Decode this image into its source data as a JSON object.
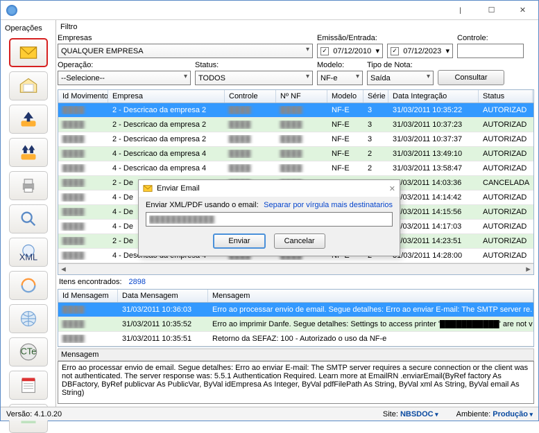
{
  "window": {
    "title": ""
  },
  "sidebar": {
    "header": "Operações"
  },
  "filter": {
    "header": "Filtro",
    "empresasLabel": "Empresas",
    "empresasValue": "QUALQUER EMPRESA",
    "operacaoLabel": "Operação:",
    "operacaoValue": "--Selecione--",
    "statusLabel": "Status:",
    "statusValue": "TODOS",
    "emissaoLabel": "Emissão/Entrada:",
    "date1": "07/12/2010",
    "date2": "07/12/2023",
    "modeloLabel": "Modelo:",
    "modeloValue": "NF-e",
    "tipoNotaLabel": "Tipo de Nota:",
    "tipoNotaValue": "Saída",
    "controleLabel": "Controle:",
    "consultar": "Consultar"
  },
  "grid1": {
    "headers": [
      "Id Movimento",
      "Empresa",
      "Controle",
      "Nº NF",
      "Modelo",
      "Série",
      "Data Integração",
      "Status"
    ],
    "rows": [
      {
        "e": "2 - Descricao da empresa 2",
        "m": "NF-E",
        "s": "3",
        "d": "31/03/2011 10:35:22",
        "st": "AUTORIZAD"
      },
      {
        "e": "2 - Descricao da empresa 2",
        "m": "NF-E",
        "s": "3",
        "d": "31/03/2011 10:37:23",
        "st": "AUTORIZAD"
      },
      {
        "e": "2 - Descricao da empresa 2",
        "m": "NF-E",
        "s": "3",
        "d": "31/03/2011 10:37:37",
        "st": "AUTORIZAD"
      },
      {
        "e": "4 - Descricao da empresa 4",
        "m": "NF-E",
        "s": "2",
        "d": "31/03/2011 13:49:10",
        "st": "AUTORIZAD"
      },
      {
        "e": "4 - Descricao da empresa 4",
        "m": "NF-E",
        "s": "2",
        "d": "31/03/2011 13:58:47",
        "st": "AUTORIZAD"
      },
      {
        "e": "2 - De",
        "m": "",
        "s": "",
        "d": "11/03/2011 14:03:36",
        "st": "CANCELADA"
      },
      {
        "e": "4 - De",
        "m": "",
        "s": "",
        "d": "11/03/2011 14:14:42",
        "st": "AUTORIZAD"
      },
      {
        "e": "4 - De",
        "m": "",
        "s": "",
        "d": "11/03/2011 14:15:56",
        "st": "AUTORIZAD"
      },
      {
        "e": "4 - De",
        "m": "",
        "s": "",
        "d": "11/03/2011 14:17:03",
        "st": "AUTORIZAD"
      },
      {
        "e": "2 - De",
        "m": "",
        "s": "",
        "d": "11/03/2011 14:23:51",
        "st": "AUTORIZAD"
      },
      {
        "e": "4 - Descricao da empresa 4",
        "m": "NF-E",
        "s": "2",
        "d": "31/03/2011 14:28:00",
        "st": "AUTORIZAD"
      }
    ]
  },
  "found": {
    "label": "Itens encontrados:",
    "count": "2898"
  },
  "grid2": {
    "headers": [
      "Id Mensagem",
      "Data Mensagem",
      "Mensagem"
    ],
    "rows": [
      {
        "d": "31/03/2011 10:36:03",
        "m": "Erro ao processar envio de email. Segue detalhes: Erro ao enviar E-mail: The SMTP server re..."
      },
      {
        "d": "31/03/2011 10:35:52",
        "m": "Erro ao imprimir Danfe. Segue detalhes: Settings to access printer '███████████' are not valid..."
      },
      {
        "d": "31/03/2011 10:35:51",
        "m": "Retorno da SEFAZ: 100 - Autorizado o uso da NF-e"
      }
    ]
  },
  "msg": {
    "header": "Mensagem",
    "text": "Erro ao processar envio de email. Segue detalhes: Erro ao enviar E-mail: The SMTP server requires a secure connection or the client was not authenticated. The server response was: 5.5.1 Authentication Required. Learn more at                                          EmailRN      .enviarEmail(ByRef factory As DBFactory, ByRef publicvar As PublicVar, ByVal idEmpresa As Integer, ByVal pdfFilePath As String, ByVal xml As String, ByVal email As String)"
  },
  "status": {
    "versaoLabel": "Versão:",
    "versao": "4.1.0.20",
    "siteLabel": "Site:",
    "site": "NBSDOC",
    "ambienteLabel": "Ambiente:",
    "ambiente": "Produção"
  },
  "dialog": {
    "title": "Enviar Email",
    "label": "Enviar XML/PDF usando o email:",
    "link": "Separar por vírgula mais destinatarios",
    "enviar": "Enviar",
    "cancelar": "Cancelar"
  }
}
